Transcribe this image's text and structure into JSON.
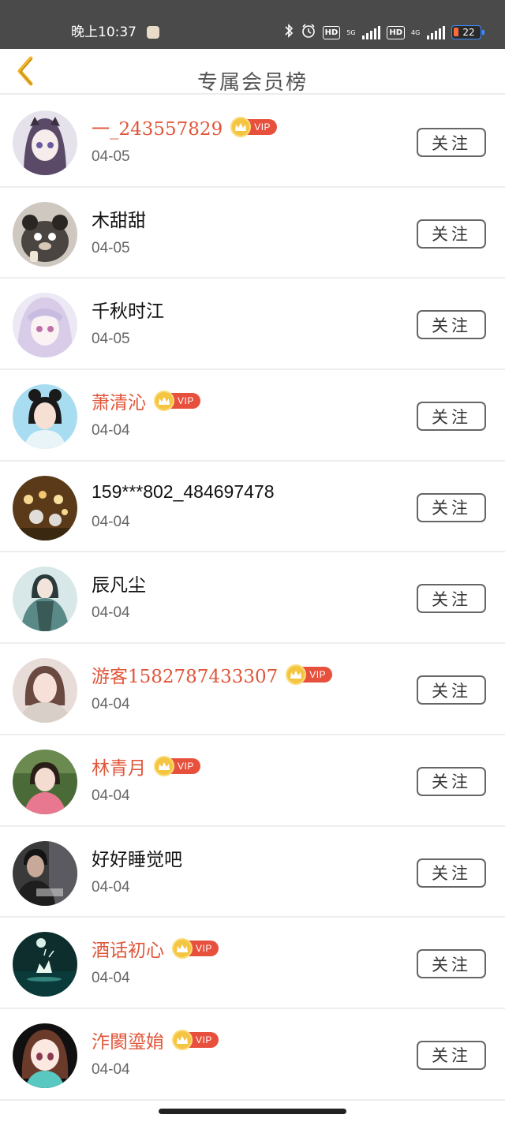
{
  "status_bar": {
    "time": "晚上10:37",
    "net_1": "5G",
    "net_2": "4G",
    "hd": "HD",
    "battery": "22"
  },
  "header": {
    "title": "专属会员榜"
  },
  "follow_label": "关注",
  "vip_label": "VIP",
  "members": [
    {
      "name": "一_243557829",
      "date": "04-05",
      "vip": true
    },
    {
      "name": "木甜甜",
      "date": "04-05",
      "vip": false
    },
    {
      "name": "千秋时江",
      "date": "04-05",
      "vip": false
    },
    {
      "name": "萧清沁",
      "date": "04-04",
      "vip": true
    },
    {
      "name": "159***802_484697478",
      "date": "04-04",
      "vip": false
    },
    {
      "name": "辰凡尘",
      "date": "04-04",
      "vip": false
    },
    {
      "name": "游客1582787433307",
      "date": "04-04",
      "vip": true
    },
    {
      "name": "林青月",
      "date": "04-04",
      "vip": true
    },
    {
      "name": "好好睡觉吧",
      "date": "04-04",
      "vip": false
    },
    {
      "name": "酒话初心",
      "date": "04-04",
      "vip": true
    },
    {
      "name": "泎閡瑬姢",
      "date": "04-04",
      "vip": true
    }
  ],
  "colors": {
    "vip_name": "#e0563a",
    "vip_badge": "#e8503e",
    "back_arrow": "#f0b428",
    "status_bar_bg": "#4a4a4a"
  }
}
